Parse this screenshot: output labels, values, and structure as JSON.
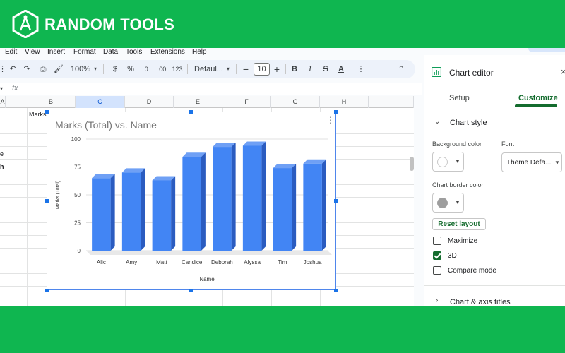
{
  "brand": {
    "name": "RANDOM TOOLS",
    "logo_icon": "compass-hexagon-icon"
  },
  "menu": [
    "Edit",
    "View",
    "Insert",
    "Format",
    "Data",
    "Tools",
    "Extensions",
    "Help"
  ],
  "toolbar": {
    "zoom": "100%",
    "currency": "$",
    "percent": "%",
    "dec_decrease": ".0",
    "dec_increase": ".00",
    "number_format": "123",
    "font": "Defaul...",
    "font_size": "10",
    "bold": "B",
    "italic": "I",
    "text_color": "A"
  },
  "formula_bar": {
    "fx": "fx"
  },
  "grid": {
    "columns": [
      "A",
      "B",
      "C",
      "D",
      "E",
      "F",
      "G",
      "H",
      "I"
    ],
    "selected_column": "C",
    "b1": "Marks",
    "a_fragments": [
      "e",
      "h"
    ]
  },
  "chart_data": {
    "type": "bar",
    "title": "Marks (Total) vs. Name",
    "xlabel": "Name",
    "ylabel": "Marks (Total)",
    "categories": [
      "Alic",
      "Amy",
      "Matt",
      "Candice",
      "Deborah",
      "Alyssa",
      "Tim",
      "Joshua"
    ],
    "values": [
      65,
      70,
      63,
      84,
      93,
      94,
      74,
      78
    ],
    "yticks": [
      0,
      25,
      50,
      75,
      100
    ],
    "ylim": [
      0,
      100
    ],
    "3d": true,
    "bar_color": "#4285f4",
    "bar_side_color": "#2b5cc0"
  },
  "sidebar": {
    "title": "Chart editor",
    "tabs": [
      "Setup",
      "Customize"
    ],
    "active_tab": "Customize",
    "section_chart_style": "Chart style",
    "background_color_label": "Background color",
    "font_label": "Font",
    "font_value": "Theme Defa...",
    "border_color_label": "Chart border color",
    "reset_layout": "Reset layout",
    "options": [
      {
        "label": "Maximize",
        "checked": false
      },
      {
        "label": "3D",
        "checked": true
      },
      {
        "label": "Compare mode",
        "checked": false
      }
    ],
    "section_axis_titles": "Chart & axis titles",
    "accent_color": "#146c2e",
    "border_swatch_color": "#9e9e9e"
  }
}
